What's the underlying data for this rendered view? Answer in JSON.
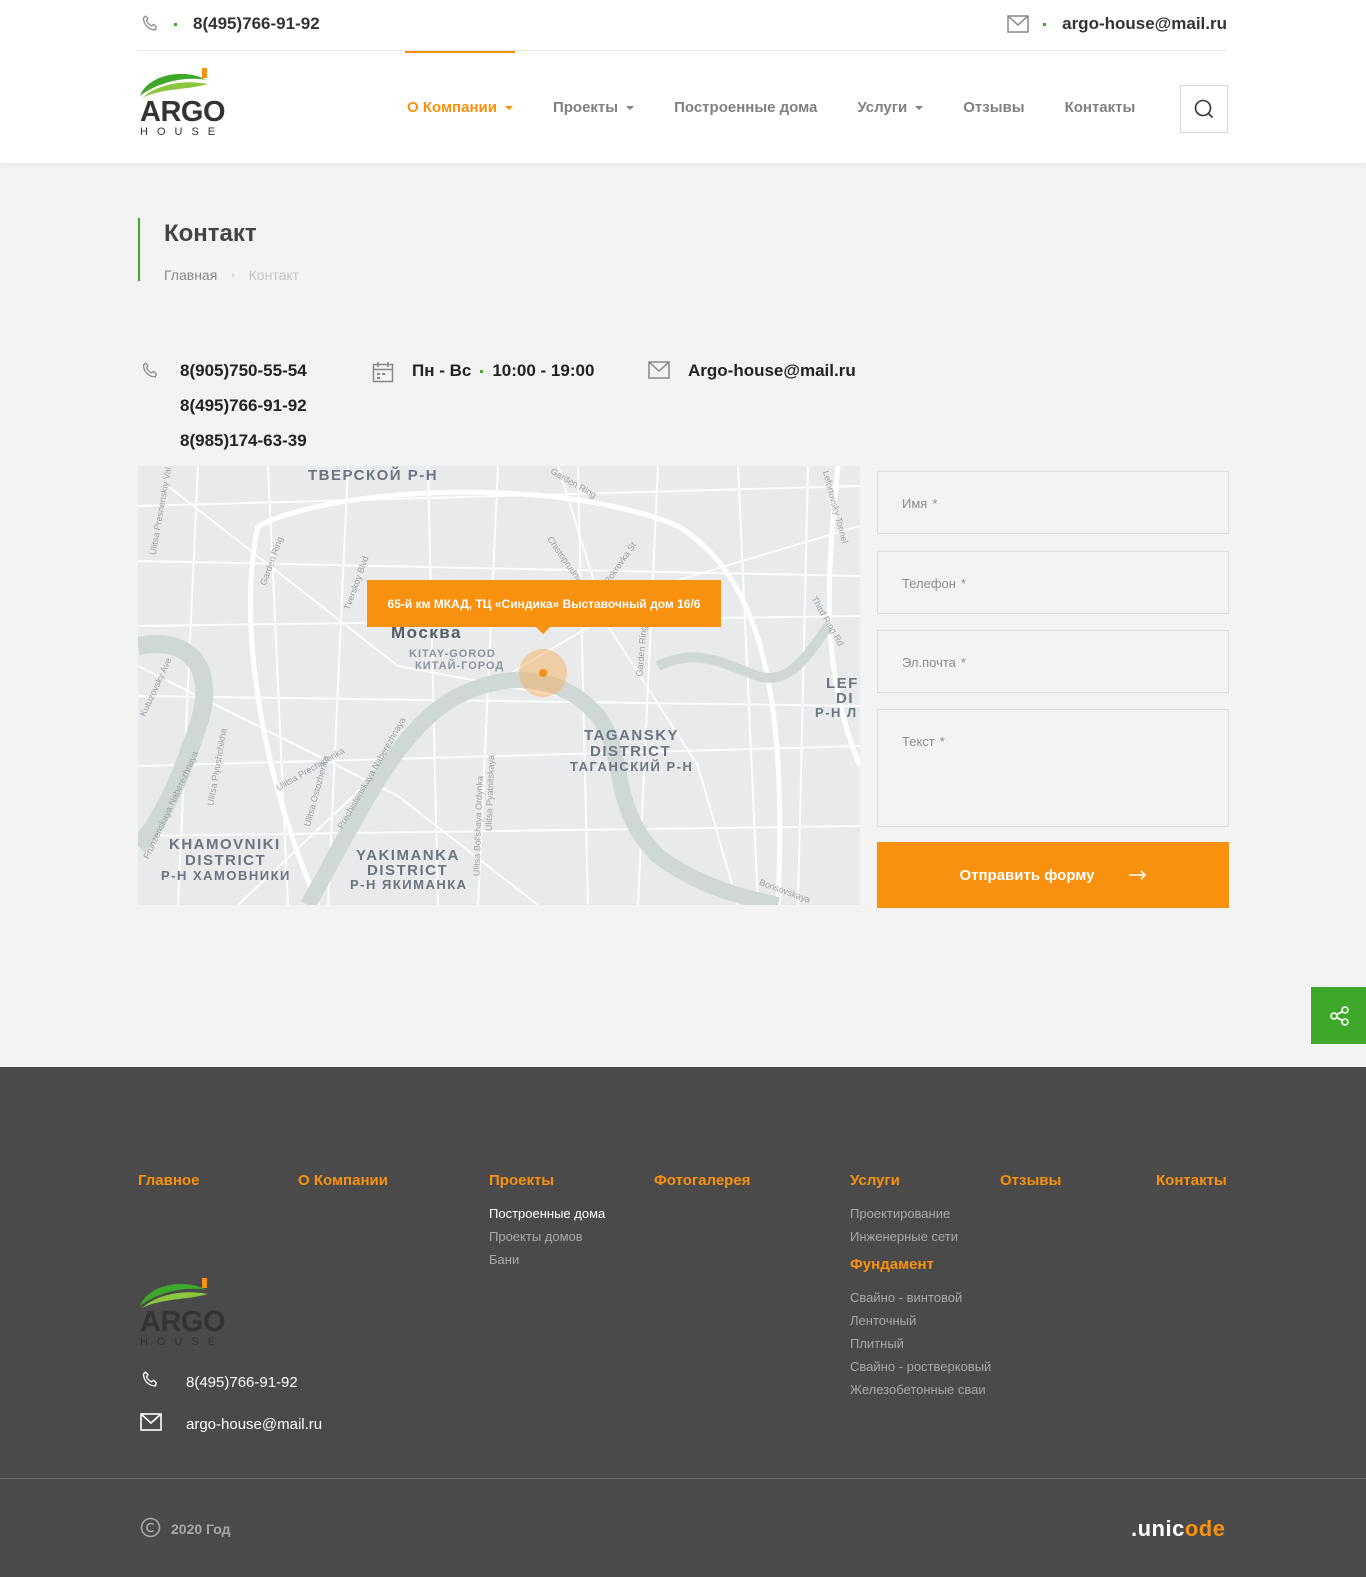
{
  "topbar": {
    "phone": "8(495)766-91-92",
    "email": "argo-house@mail.ru"
  },
  "logo": {
    "word": "ARGO",
    "sub": "HOUSE"
  },
  "nav": [
    {
      "label": "О Компании",
      "dropdown": true,
      "active": true
    },
    {
      "label": "Проекты",
      "dropdown": true
    },
    {
      "label": "Построенные дома",
      "dropdown": false
    },
    {
      "label": "Услуги",
      "dropdown": true
    },
    {
      "label": "Отзывы",
      "dropdown": false
    },
    {
      "label": "Контакты",
      "dropdown": false
    }
  ],
  "page": {
    "title": "Контакт",
    "breadcrumb_home": "Главная",
    "breadcrumb_current": "Контакт"
  },
  "contacts": {
    "phones": [
      "8(905)750-55-54",
      "8(495)766-91-92",
      "8(985)174-63-39"
    ],
    "days": "Пн - Вс",
    "time": "10:00 - 19:00",
    "email": "Argo-house@mail.ru"
  },
  "map": {
    "tooltip": "65-й км МКАД, ТЦ «Синдика» Выставочный дом 16/6",
    "labels": {
      "tverskoy": "ТВЕРСКОЙ Р-Н",
      "moscow": "Москва",
      "kitay_en": "KITAY-GOROD",
      "kitay_ru": "КИТАЙ-ГОРОД",
      "taganskiy_1": "TAGANSKY",
      "taganskiy_2": "DISTRICT",
      "taganskiy_3": "ТАГАНСКИЙ Р-Н",
      "khamovniki_1": "KHAMOVNIKI",
      "khamovniki_2": "DISTRICT",
      "khamovniki_3": "Р-Н ХАМОВНИКИ",
      "yakimanka_1": "YAKIMANKA",
      "yakimanka_2": "DISTRICT",
      "yakimanka_3": "Р-Н ЯКИМАНКА",
      "lef_1": "LEF",
      "lef_2": "DI",
      "lef_3": "Р-Н Л"
    },
    "streets": {
      "garden_ring_top": "Garden Ring",
      "garden_ring_left": "Garden Ring",
      "garden_ring_right": "Garden Ring",
      "third_ring": "Third Ring Rd",
      "tverskoy_blvd": "Tverskoy Blvd",
      "kutuzovsky": "Kutuzovsky Ave",
      "lefortovsky": "Lefortovsky Tonnel",
      "chistoprudny": "Chistoprudny",
      "pokrovka": "Pokrovka St",
      "presnenskiy": "Ulitsa Presnenskiy Val",
      "prechistenka": "Ulitsa Prechistenka",
      "ostozhenka": "Ulitsa Ostozhenka",
      "pyatnitskaya": "Ulitsa Pyatnitskaya",
      "ordynka": "Ulitsa Bol'shaya Ordynka",
      "prech_nab": "Prechistenskaya Naberezhnaya",
      "plyushchikha": "Ulitsa Plyushchikha",
      "frunz_nab": "Frunzenskaya Naberezhnaya",
      "borisov": "Borisovskaya"
    }
  },
  "form": {
    "name_placeholder": "Имя",
    "phone_placeholder": "Телефон",
    "email_placeholder": "Эл.почта",
    "text_placeholder": "Текст",
    "required_mark": "*",
    "submit": "Отправить форму"
  },
  "footer": {
    "cols": {
      "home": "Главное",
      "about": "О Компании",
      "projects": "Проекты",
      "gallery": "Фотогалерея",
      "services": "Услуги",
      "reviews": "Отзывы",
      "contacts": "Контакты"
    },
    "projects_links": [
      "Построенные дома",
      "Проекты домов",
      "Бани"
    ],
    "services_links": [
      "Проектирование",
      "Инженерные сети"
    ],
    "foundation_title": "Фундамент",
    "foundation_links": [
      "Свайно - винтовой",
      "Ленточный",
      "Плитный",
      "Свайно - ростверковый",
      "Железобетонные сваи"
    ],
    "phone": "8(495)766-91-92",
    "email": "argo-house@mail.ru",
    "copyright": "2020 Год",
    "developer_prefix": ".unic",
    "developer_o": "o",
    "developer_suffix": "de"
  },
  "colors": {
    "accent": "#f7910f",
    "green": "#3ea82a",
    "footer_bg": "#4a4a4a"
  },
  "icons": [
    "phone-icon",
    "mail-icon",
    "calendar-icon",
    "search-icon",
    "share-icon",
    "arrow-right-icon",
    "copyright-icon"
  ]
}
